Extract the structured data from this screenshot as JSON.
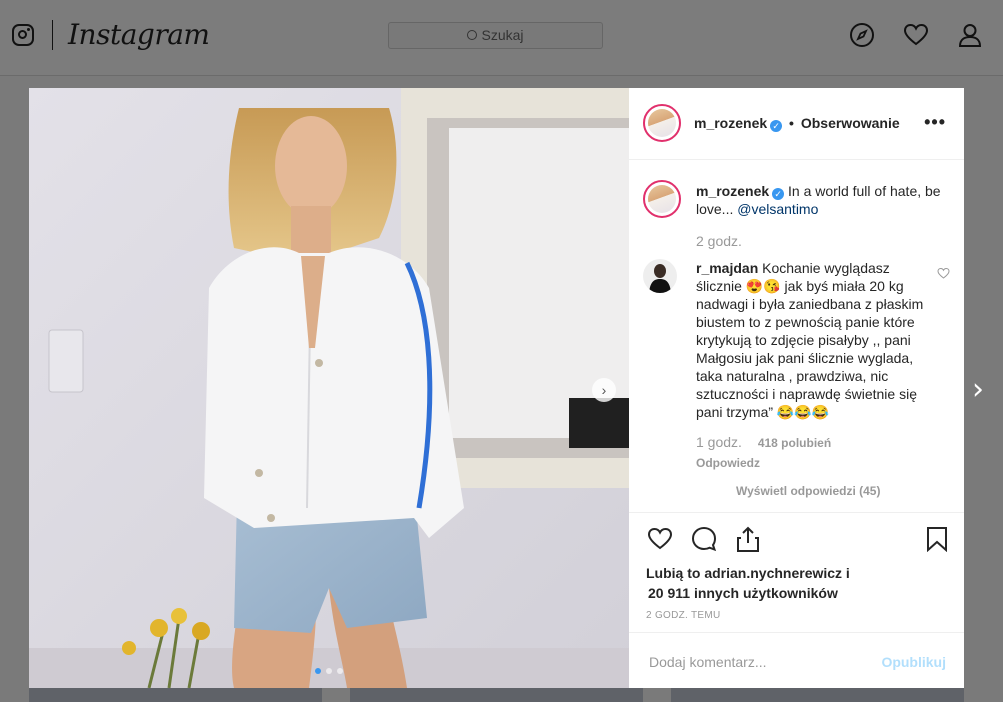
{
  "topbar": {
    "brand": "Instagram",
    "search_placeholder": "Szukaj"
  },
  "post": {
    "author": "m_rozenek",
    "follow_state": "Obserwowanie",
    "more_label": "•••",
    "caption": "In a world full of hate, be love...",
    "caption_mention": "@velsantimo",
    "caption_time": "2 godz.",
    "likes_line1": "Lubią to adrian.nychnerewicz i",
    "likes_line2": "20 911 innych użytkowników",
    "timestamp": "2 GODZ. TEMU",
    "comment_placeholder": "Dodaj komentarz...",
    "publish_label": "Opublikuj"
  },
  "comment": {
    "author": "r_majdan",
    "text": "Kochanie wyglądasz ślicznie 😍😘 jak byś miała 20 kg nadwagi i była zaniedbana z płaskim biustem to z pewnością panie które krytykują to zdjęcie pisałyby ,, pani Małgosiu jak pani ślicznie wyglada, taka naturalna , prawdziwa, nic sztuczności i naprawdę świetnie się pani trzyma” 😂😂😂",
    "time": "1 godz.",
    "likes": "418 polubień",
    "reply_label": "Odpowiedz",
    "view_replies": "Wyświetl odpowiedzi (45)"
  },
  "carousel": {
    "next_arrow": "›",
    "dots": 3,
    "active_dot": 1
  },
  "post_nav": {
    "next_arrow": "›"
  },
  "colors": {
    "verified": "#3897f0",
    "publish_disabled": "#b2dffc",
    "story_ring": "#e1306c"
  }
}
